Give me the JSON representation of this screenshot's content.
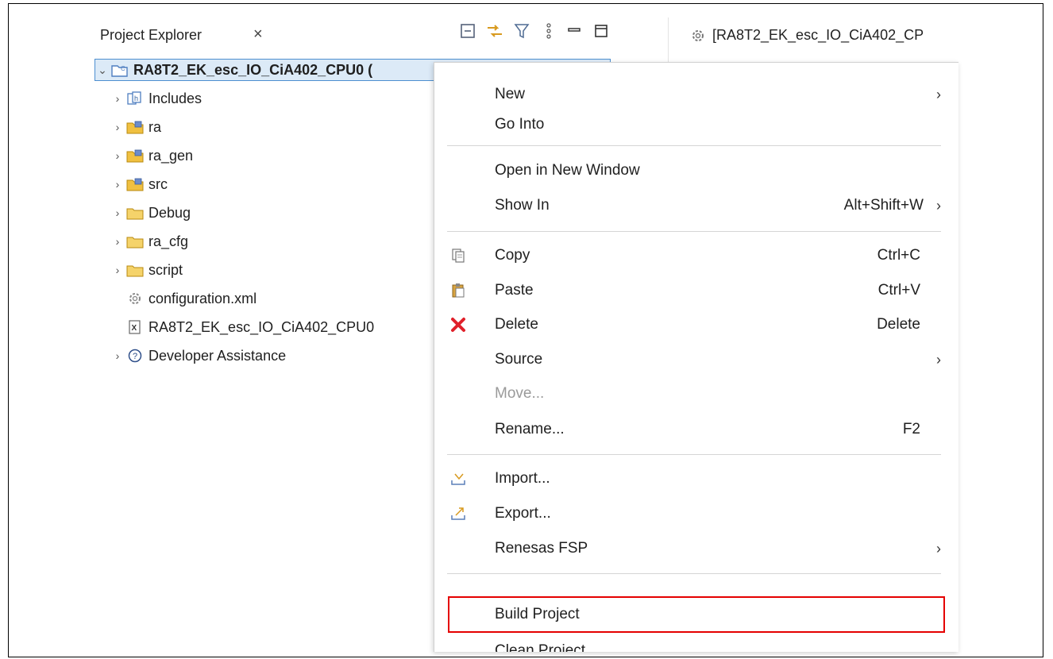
{
  "project_explorer": {
    "title": "Project Explorer",
    "toolbar_icons": [
      "collapse-all-icon",
      "link-with-editor-icon",
      "filter-icon",
      "view-menu-icon",
      "minimize-icon",
      "maximize-icon"
    ],
    "tree": [
      {
        "label": "RA8T2_EK_esc_IO_CiA402_CPU0 (",
        "icon": "project-folder-icon",
        "expanded": true,
        "selected": true
      },
      {
        "label": "Includes",
        "icon": "includes-icon"
      },
      {
        "label": "ra",
        "icon": "source-folder-icon"
      },
      {
        "label": "ra_gen",
        "icon": "source-folder-icon"
      },
      {
        "label": "src",
        "icon": "source-folder-icon"
      },
      {
        "label": "Debug",
        "icon": "folder-icon"
      },
      {
        "label": "ra_cfg",
        "icon": "folder-icon"
      },
      {
        "label": "script",
        "icon": "folder-icon"
      },
      {
        "label": "configuration.xml",
        "icon": "gear-file-icon"
      },
      {
        "label": "RA8T2_EK_esc_IO_CiA402_CPU0",
        "icon": "xml-file-icon"
      },
      {
        "label": "Developer Assistance",
        "icon": "help-icon"
      }
    ]
  },
  "editor_tab": {
    "title": "[RA8T2_EK_esc_IO_CiA402_CP"
  },
  "context_menu": {
    "items": [
      {
        "label": "New",
        "submenu": true
      },
      {
        "label": "Go Into"
      },
      {
        "label": "Open in New Window"
      },
      {
        "label": "Show In",
        "shortcut": "Alt+Shift+W",
        "submenu": true
      },
      {
        "label": "Copy",
        "shortcut": "Ctrl+C",
        "icon": "copy-icon"
      },
      {
        "label": "Paste",
        "shortcut": "Ctrl+V",
        "icon": "paste-icon"
      },
      {
        "label": "Delete",
        "shortcut": "Delete",
        "icon": "delete-icon"
      },
      {
        "label": "Source",
        "submenu": true
      },
      {
        "label": "Move...",
        "disabled": true
      },
      {
        "label": "Rename...",
        "shortcut": "F2"
      },
      {
        "label": "Import...",
        "icon": "import-icon"
      },
      {
        "label": "Export...",
        "icon": "export-icon"
      },
      {
        "label": "Renesas FSP",
        "submenu": true
      },
      {
        "label": "Build Project",
        "highlighted": true
      },
      {
        "label": "Clean Project"
      }
    ],
    "highlight_color": "#e50000"
  },
  "colors": {
    "selection_bg": "#dceaf7",
    "selection_border": "#4d8fd0",
    "folder_yellow": "#f0c040",
    "delete_red": "#e0202a"
  }
}
